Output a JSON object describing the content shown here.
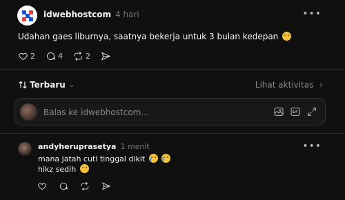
{
  "post": {
    "author": "idwebhostcom",
    "time": "4 hari",
    "text": "Udahan gaes liburnya, saatnya bekerja untuk 3 bulan kedepan",
    "text_emoji": "grimacing-face",
    "likes": "2",
    "comments": "4",
    "reposts": "2",
    "more_label": "•••"
  },
  "sort": {
    "label": "Terbaru",
    "icon": "sort-arrows-icon",
    "activity_label": "Lihat aktivitas"
  },
  "reply": {
    "placeholder": "Balas ke idwebhostcom..."
  },
  "comment": {
    "author": "andyheruprasetya",
    "time": "1 menit",
    "line1": "mana jatah cuti tinggal dikit",
    "line1_emoji": [
      "crying-face",
      "crying-face"
    ],
    "line2": "hikz sedih",
    "line2_emoji": "sad-face",
    "more_label": "•••"
  },
  "colors": {
    "background": "#101010",
    "text": "#f3f5f7",
    "muted": "#777777",
    "border": "#2a2a2a",
    "logo_blue": "#1a4fd6",
    "logo_red": "#e8423f"
  }
}
